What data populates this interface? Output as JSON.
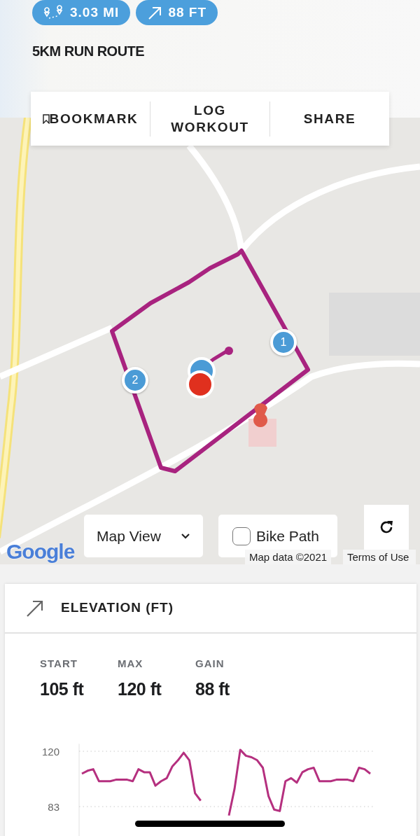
{
  "header": {
    "stats": [
      {
        "kind": "distance",
        "value": "3.03 MI"
      },
      {
        "kind": "climb",
        "value": "88 FT"
      }
    ],
    "title": "5KM RUN ROUTE"
  },
  "actions": [
    {
      "kind": "bookmark",
      "label": "BOOKMARK"
    },
    {
      "kind": "text",
      "label": "LOG WORKOUT"
    },
    {
      "kind": "text",
      "label": "SHARE"
    }
  ],
  "map": {
    "markers": [
      "1",
      "2"
    ],
    "view_select": {
      "value": "Map View"
    },
    "bike_path": {
      "label": "Bike Path",
      "checked": false
    },
    "logo": "Google",
    "attribution": "Map data ©2021",
    "terms": "Terms of Use"
  },
  "elevation": {
    "title": "ELEVATION (FT)",
    "stats": [
      {
        "label": "START",
        "value": "105 ft"
      },
      {
        "label": "MAX",
        "value": "120 ft"
      },
      {
        "label": "GAIN",
        "value": "88 ft"
      }
    ],
    "chart_data": {
      "type": "line",
      "yticks": [
        83,
        120
      ],
      "ylim": [
        60,
        125
      ],
      "series": [
        {
          "color": "#b5307f",
          "values": [
            105,
            107,
            108,
            100,
            100,
            100,
            101,
            101,
            101,
            100,
            108,
            106,
            106,
            97,
            100,
            102,
            110,
            114,
            119,
            114,
            92,
            87,
            null,
            null,
            null,
            null,
            77,
            95,
            121,
            117,
            116,
            114,
            109,
            90,
            81,
            80,
            100,
            102,
            99,
            106,
            108,
            109,
            100,
            100,
            100,
            101,
            101,
            101,
            100,
            109,
            108,
            105
          ]
        }
      ]
    }
  }
}
